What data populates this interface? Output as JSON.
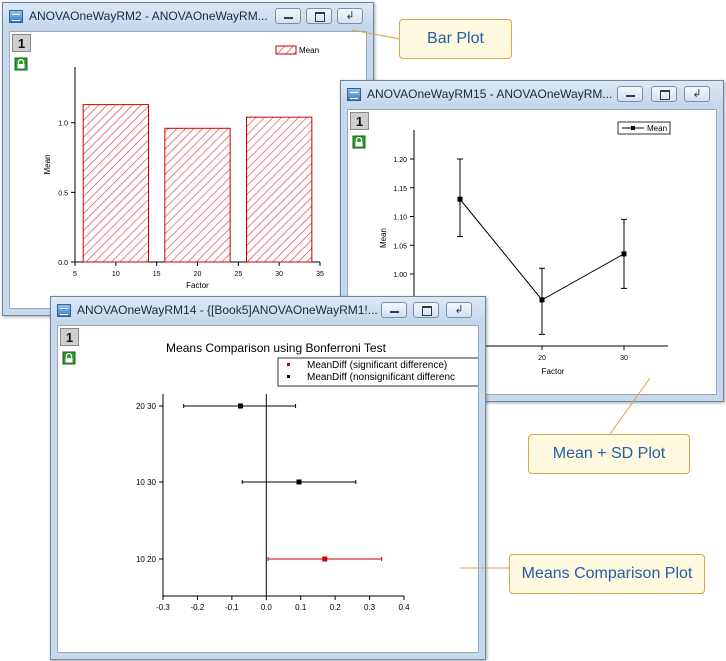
{
  "windows": {
    "bar": {
      "title": "ANOVAOneWayRM2 - ANOVAOneWayRM...",
      "layer": "1",
      "chart_data": {
        "type": "bar",
        "x": [
          10,
          20,
          30
        ],
        "values": [
          1.13,
          0.96,
          1.04
        ],
        "bar_width": 8,
        "xlim": [
          5,
          35
        ],
        "ylim": [
          0,
          1.4
        ],
        "xticks": [
          "5",
          "10",
          "15",
          "20",
          "25",
          "30",
          "35"
        ],
        "yticks": [
          "0.0",
          "0.5",
          "1.0"
        ],
        "xlabel": "Factor",
        "ylabel": "Mean",
        "legend": "Mean",
        "legend_position": "top-right",
        "fill": "red diagonal hatch",
        "color": "#cc0000"
      }
    },
    "line": {
      "title": "ANOVAOneWayRM15 - ANOVAOneWayRM...",
      "layer": "1",
      "chart_data": {
        "type": "line",
        "x": [
          10,
          20,
          30
        ],
        "values": [
          1.13,
          0.955,
          1.035
        ],
        "err_low": [
          1.065,
          0.895,
          0.975
        ],
        "err_high": [
          1.2,
          1.01,
          1.095
        ],
        "xticks_visible": [
          "20",
          "30"
        ],
        "yticks": [
          "1.00",
          "1.05",
          "1.10",
          "1.15",
          "1.20"
        ],
        "xlabel": "Factor",
        "ylabel": "Mean",
        "legend": "Mean",
        "legend_position": "top-right",
        "color": "#000000"
      }
    },
    "means": {
      "title": "ANOVAOneWayRM14 - {[Book5]ANOVAOneWayRM1!...",
      "layer": "1",
      "chart_data": {
        "type": "scatter",
        "title": "Means Comparison using Bonferroni Test",
        "categories": [
          "20 30",
          "10 30",
          "10 20"
        ],
        "values": [
          -0.075,
          0.095,
          0.17
        ],
        "ci_low": [
          -0.24,
          -0.07,
          0.005
        ],
        "ci_high": [
          0.085,
          0.26,
          0.335
        ],
        "significant": [
          false,
          false,
          true
        ],
        "xlim": [
          -0.3,
          0.4
        ],
        "xticks": [
          "-0.3",
          "-0.2",
          "-0.1",
          "0.0",
          "0.1",
          "0.2",
          "0.3",
          "0.4"
        ],
        "legend": [
          "MeanDiff (significant difference)",
          "MeanDiff (nonsignificant differenc"
        ],
        "legend_position": "top-right",
        "colors": {
          "significant": "#cc0000",
          "nonsignificant": "#000000"
        }
      }
    }
  },
  "callouts": {
    "bar": "Bar Plot",
    "sd": "Mean + SD Plot",
    "means": "Means Comparison Plot"
  }
}
